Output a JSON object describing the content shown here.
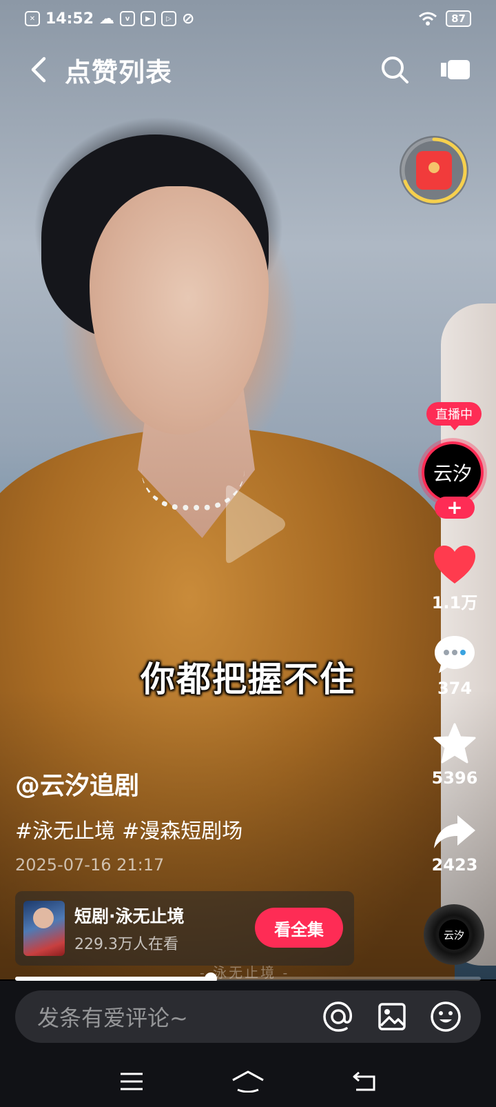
{
  "status_bar": {
    "time": "14:52",
    "battery": "87",
    "app_icons": [
      "sim-card-icon",
      "cloud-icon",
      "vivo-icon",
      "video-app-icon",
      "play-app-icon",
      "leaf-icon"
    ]
  },
  "header": {
    "title": "点赞列表"
  },
  "video": {
    "subtitle": "你都把握不住",
    "author": "@云汐追剧",
    "hashtags": [
      "#泳无止境",
      "#漫森短剧场"
    ],
    "date": "2025-07-16 21:17",
    "watermark": "- 泳无止境 -",
    "progress": 0.42
  },
  "sidebar": {
    "live_badge": "直播中",
    "avatar_text": "云汐",
    "follow_label": "+",
    "likes": "1.1万",
    "comments": "374",
    "favorites": "5396",
    "shares": "2423",
    "disc_text": "云汐"
  },
  "drama_card": {
    "title": "短剧·泳无止境",
    "viewers": "229.3万人在看",
    "button": "看全集"
  },
  "comment_bar": {
    "placeholder": "发条有爱评论~"
  },
  "colors": {
    "accent": "#fe2c55",
    "like": "#ff3b4e",
    "background": "#000000"
  }
}
